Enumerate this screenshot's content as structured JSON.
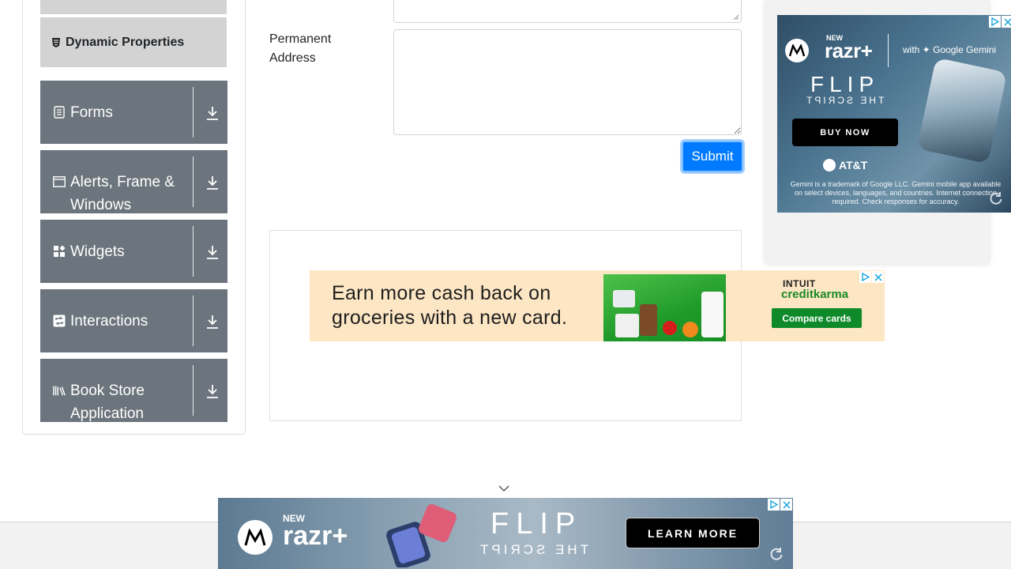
{
  "sidebar": {
    "active_item": "Dynamic Properties",
    "groups": [
      {
        "label": "Forms",
        "icon": "form-icon"
      },
      {
        "label": "Alerts, Frame & Windows",
        "icon": "window-icon"
      },
      {
        "label": "Widgets",
        "icon": "widgets-icon"
      },
      {
        "label": "Interactions",
        "icon": "interactions-icon"
      },
      {
        "label": "Book Store Application",
        "icon": "books-icon"
      }
    ]
  },
  "form": {
    "permanent_address_label": "Permanent Address",
    "permanent_address_value": "",
    "submit_label": "Submit"
  },
  "ads": {
    "middle": {
      "headline": "Earn more cash back on groceries with a new card.",
      "brand_line1": "INTUIT",
      "brand_line2": "creditkarma",
      "cta": "Compare cards"
    },
    "right": {
      "new_tag": "NEW",
      "product": "razr+",
      "partner": "with ✦ Google Gemini",
      "headline": "FLIP",
      "subheadline": "THE SCRIPT",
      "cta": "BUY NOW",
      "carrier": "AT&T",
      "fine_print": "Gemini is a trademark of Google LLC. Gemini mobile app available on select devices, languages, and countries. Internet connection required. Check responses for accuracy."
    },
    "bottom": {
      "new_tag": "NEW",
      "product": "razr+",
      "headline": "FLIP",
      "subheadline": "THE SCRIPT",
      "cta": "LEARN MORE"
    }
  },
  "colors": {
    "group_bg": "#6c757d",
    "submenu_bg": "#d3d3d3",
    "primary": "#007bff"
  }
}
